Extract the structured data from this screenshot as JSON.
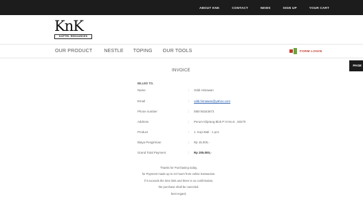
{
  "top_nav": {
    "items": [
      "ABOUT KNK",
      "CONTACT",
      "NEWS",
      "SIGN UP",
      "YOUR CART"
    ]
  },
  "logo": {
    "mark": "KnK",
    "band": "KOPTEL RESOURCES"
  },
  "main_nav": {
    "items": [
      "OUR PRODUCT",
      "NESTLE",
      "TOPING",
      "OUR TOOLS"
    ]
  },
  "form_login": {
    "label": "FORM LOGIN",
    "icon": "form-login-icon"
  },
  "page_tab": {
    "label": "PAGE"
  },
  "invoice": {
    "title": "INVOICE",
    "billed_to": "BILLED TO.",
    "rows": [
      {
        "label": "Name",
        "sep": ":",
        "value": "Oddi Himawan"
      },
      {
        "label": "Email",
        "sep": ":",
        "value": "oddi.himawan@yahoo.com"
      },
      {
        "label": "Phone number",
        "sep": ":",
        "value": "085746343673"
      },
      {
        "label": "Address",
        "sep": ":",
        "value": "Perum Kliprang Blok P III No.6 , 50270"
      },
      {
        "label": "Product",
        "sep": ":",
        "value": "1. Kopi Bali - 1 pcs"
      },
      {
        "label": "Biaya Pengiriman",
        "sep": ":",
        "value": "Rp 15.000,-"
      },
      {
        "label": "Grand Total Payment",
        "sep": ":",
        "value": "Rp 205.000,-"
      }
    ],
    "notes": [
      "Thanks for Purchasing today,",
      "for Payment made up to 24 hours from online transaction.",
      "if it exceeds the time limit and there is no confirmation,",
      "the purchase shall be canceled.",
      "best regard,"
    ]
  },
  "colors": {
    "topbar": "#1c1c1c",
    "link": "#2a5db0",
    "login_red": "#c03a2a",
    "login_green": "#6aa53b"
  }
}
